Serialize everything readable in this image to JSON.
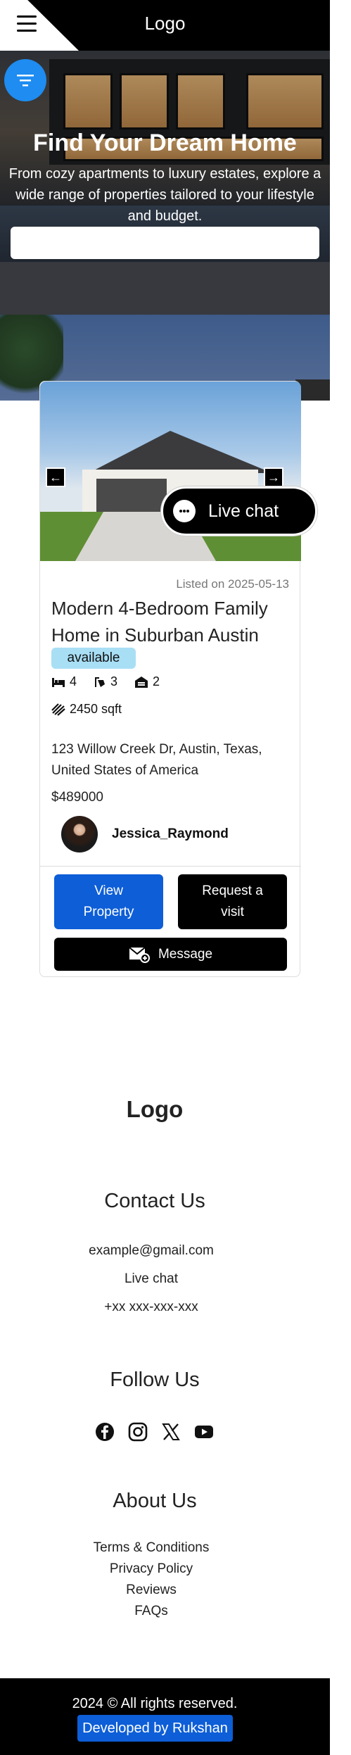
{
  "header": {
    "logo": "Logo"
  },
  "hero": {
    "title": "Find Your Dream Home",
    "subtitle": "From cozy apartments to luxury estates, explore a wide range of properties tailored to your lifestyle and budget.",
    "search_placeholder": ""
  },
  "listing": {
    "listed": "Listed on 2025-05-13",
    "title": "Modern 4-Bedroom Family Home in Suburban Austin",
    "status": "available",
    "beds": "4",
    "baths": "3",
    "garage": "2",
    "area": "2450 sqft",
    "address": "123 Willow Creek Dr, Austin, Texas, United States of America",
    "price": "$489000",
    "agent": "Jessica_Raymond",
    "view_label": "View Property",
    "request_label": "Request a visit",
    "message_label": "Message"
  },
  "live_chat": {
    "label": "Live chat"
  },
  "footer": {
    "logo": "Logo",
    "contact_heading": "Contact Us",
    "email": "example@gmail.com",
    "live_chat": "Live chat",
    "phone": "+xx xxx-xxx-xxx",
    "follow_heading": "Follow Us",
    "socials": [
      "facebook-icon",
      "instagram-icon",
      "x-icon",
      "youtube-icon"
    ],
    "about_heading": "About Us",
    "links": [
      "Terms & Conditions",
      "Privacy Policy",
      "Reviews",
      "FAQs"
    ],
    "copyright": "2024 © All rights reserved.",
    "developer": "Developed by Rukshan"
  },
  "colors": {
    "primary": "#0d5ed7",
    "filter": "#1e8cf0",
    "badge": "#a8dff5"
  }
}
